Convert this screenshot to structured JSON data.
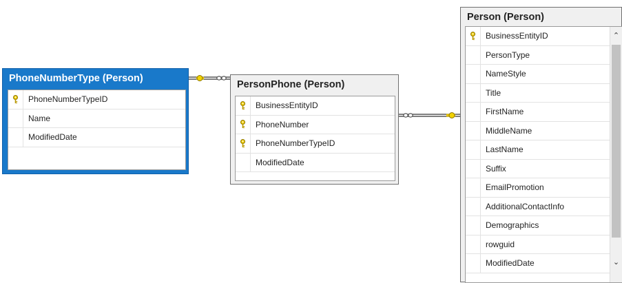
{
  "tables": {
    "phone_number_type": {
      "title": "PhoneNumberType (Person)",
      "columns": [
        {
          "name": "PhoneNumberTypeID",
          "key": true
        },
        {
          "name": "Name",
          "key": false
        },
        {
          "name": "ModifiedDate",
          "key": false
        }
      ]
    },
    "person_phone": {
      "title": "PersonPhone (Person)",
      "columns": [
        {
          "name": "BusinessEntityID",
          "key": true
        },
        {
          "name": "PhoneNumber",
          "key": true
        },
        {
          "name": "PhoneNumberTypeID",
          "key": true
        },
        {
          "name": "ModifiedDate",
          "key": false
        }
      ]
    },
    "person": {
      "title": "Person (Person)",
      "columns": [
        {
          "name": "BusinessEntityID",
          "key": true
        },
        {
          "name": "PersonType",
          "key": false
        },
        {
          "name": "NameStyle",
          "key": false
        },
        {
          "name": "Title",
          "key": false
        },
        {
          "name": "FirstName",
          "key": false
        },
        {
          "name": "MiddleName",
          "key": false
        },
        {
          "name": "LastName",
          "key": false
        },
        {
          "name": "Suffix",
          "key": false
        },
        {
          "name": "EmailPromotion",
          "key": false
        },
        {
          "name": "AdditionalContactInfo",
          "key": false
        },
        {
          "name": "Demographics",
          "key": false
        },
        {
          "name": "rowguid",
          "key": false
        },
        {
          "name": "ModifiedDate",
          "key": false
        }
      ]
    }
  },
  "colors": {
    "selected_header": "#1979ca",
    "key_icon": "#d9b200",
    "connector": "#555555",
    "connector_key": "#e8c400"
  },
  "icons": {
    "primary_key": "key-icon",
    "scroll_up": "chevron-up-icon",
    "scroll_down": "chevron-down-icon"
  }
}
